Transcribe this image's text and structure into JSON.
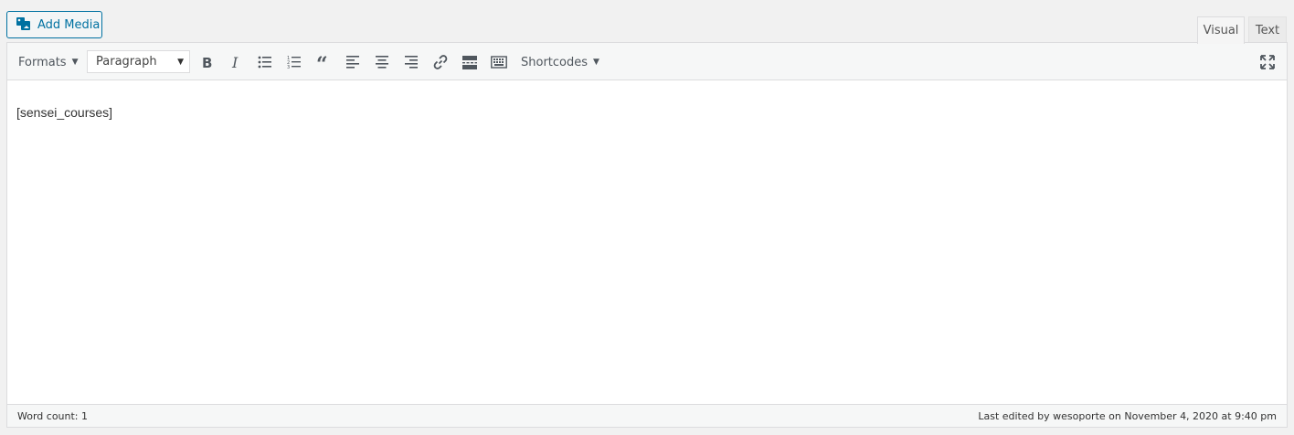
{
  "add_media": {
    "label": "Add Media",
    "icon": "media-icon"
  },
  "tabs": {
    "visual": "Visual",
    "text": "Text"
  },
  "toolbar": {
    "formats_label": "Formats",
    "paragraph_value": "Paragraph",
    "shortcodes_label": "Shortcodes"
  },
  "content": {
    "text": "[sensei_courses]"
  },
  "status": {
    "word_count": "Word count: 1",
    "last_edited": "Last edited by wesoporte on November 4, 2020 at 9:40 pm"
  }
}
